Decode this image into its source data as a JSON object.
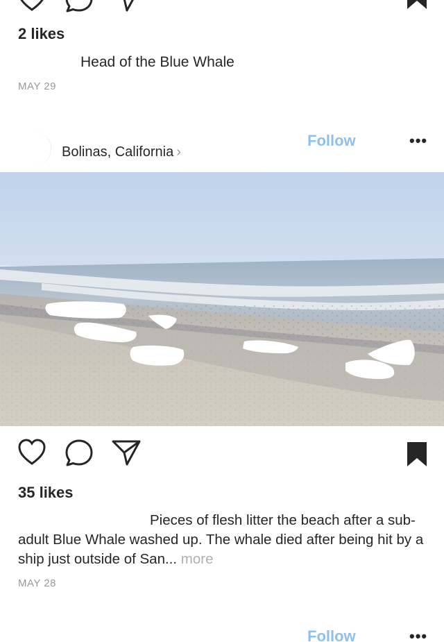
{
  "post1": {
    "likes": "2 likes",
    "caption": "Head of the Blue Whale",
    "date": "MAY 29"
  },
  "post2": {
    "location": "Bolinas, California",
    "follow_label": "Follow",
    "more_label": "•••",
    "photo_icon": "beach-photo",
    "likes": "35 likes",
    "caption": "Pieces of flesh litter the beach after a sub-adult Blue Whale washed up. The whale died after being hit by a ship just outside of San...",
    "more_text": "more",
    "date": "MAY 28"
  },
  "post3": {
    "follow_label": "Follow",
    "more_label": "•••"
  },
  "colors": {
    "follow": "#8ec0ea",
    "date": "#999999",
    "text": "#262626"
  },
  "icons": [
    "heart-icon",
    "comment-icon",
    "share-icon",
    "bookmark-icon"
  ]
}
